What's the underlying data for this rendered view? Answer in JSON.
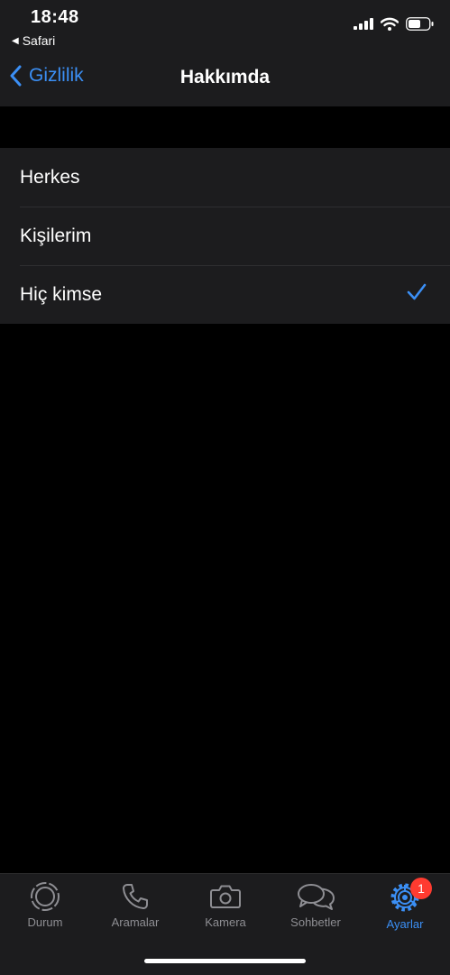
{
  "status_bar": {
    "time": "18:48",
    "back_app": "Safari",
    "icons": [
      "cellular-signal-icon",
      "wifi-icon",
      "battery-icon"
    ]
  },
  "nav": {
    "back_label": "Gizlilik",
    "title": "Hakkımda"
  },
  "options": [
    {
      "label": "Herkes",
      "selected": false
    },
    {
      "label": "Kişilerim",
      "selected": false
    },
    {
      "label": "Hiç kimse",
      "selected": true
    }
  ],
  "tabbar": {
    "tabs": [
      {
        "label": "Durum",
        "icon": "status-icon"
      },
      {
        "label": "Aramalar",
        "icon": "phone-icon"
      },
      {
        "label": "Kamera",
        "icon": "camera-icon"
      },
      {
        "label": "Sohbetler",
        "icon": "chats-icon"
      },
      {
        "label": "Ayarlar",
        "icon": "settings-gear-icon",
        "active": true,
        "badge": "1"
      }
    ]
  },
  "colors": {
    "accent": "#3b8ff5",
    "background": "#000000",
    "surface": "#1c1c1e",
    "badge": "#ff3b30",
    "inactive": "#8e8e93"
  }
}
